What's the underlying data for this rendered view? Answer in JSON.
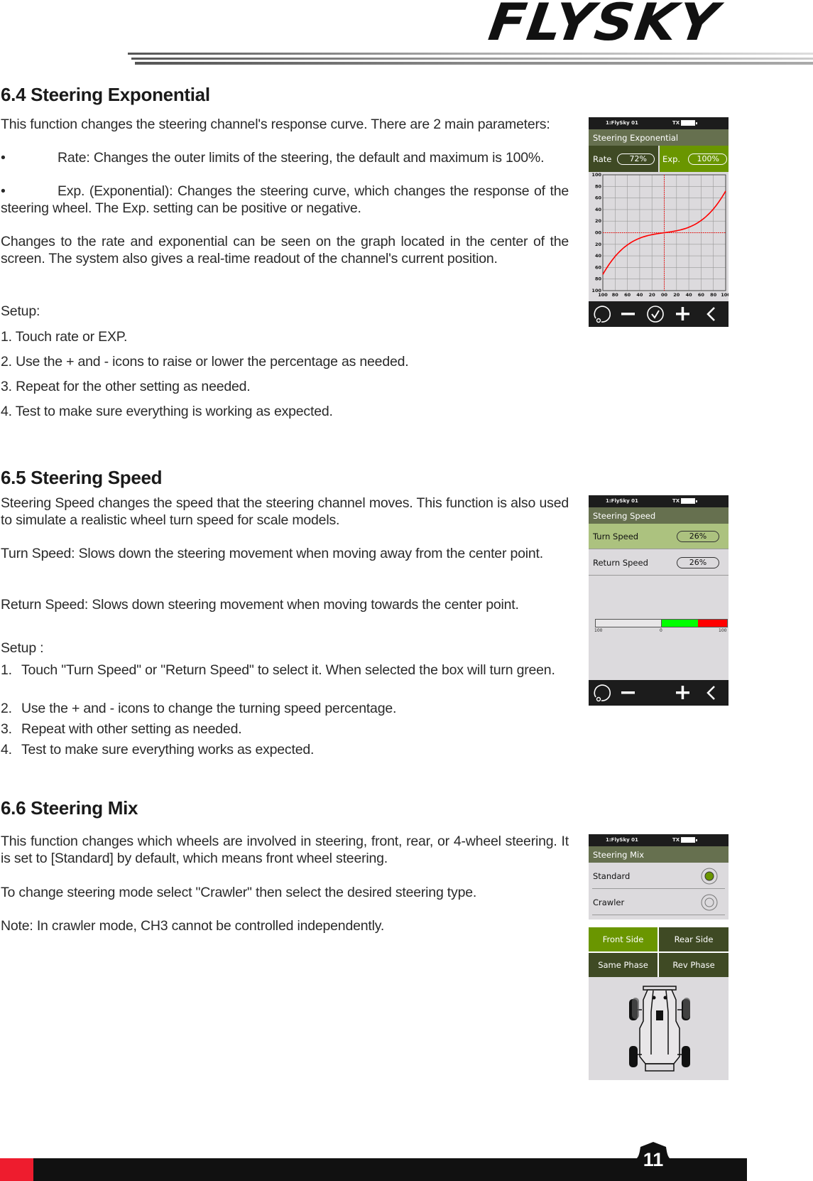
{
  "header": {
    "logo": "FLYSKY"
  },
  "s64": {
    "title": "6.4 Steering Exponential",
    "p1": "This function changes the steering channel's response curve. There are 2 main parameters:",
    "b1": "Rate: Changes the outer limits of the steering, the default and maximum is 100%.",
    "b2": "Exp. (Exponential): Changes the steering curve, which changes the response of the steering wheel. The Exp. setting can be positive or negative.",
    "p2": "Changes to the rate and exponential can be seen on the graph located in the center of the screen. The system also gives a real-time readout of the channel's current position.",
    "setup": "Setup:",
    "steps": [
      "1. Touch rate or EXP.",
      "2. Use the + and - icons to raise or lower the percentage as needed.",
      "3. Repeat for the other setting as needed.",
      "4. Test to make sure everything is working as expected."
    ],
    "screen": {
      "model": "1:FlySky 01",
      "tx": "TX",
      "title": "Steering Exponential",
      "rate_label": "Rate",
      "rate_value": "72%",
      "rate": 72,
      "exp_label": "Exp.",
      "exp_value": "100%",
      "exp": 100,
      "y_ticks": [
        "100",
        "80",
        "60",
        "40",
        "20",
        "00",
        "20",
        "40",
        "60",
        "80",
        "100"
      ],
      "x_ticks": [
        "100",
        "80",
        "60",
        "40",
        "20",
        "00",
        "20",
        "40",
        "60",
        "80",
        "100"
      ],
      "icons": [
        "reset-icon",
        "minus-icon",
        "check-icon",
        "plus-icon",
        "back-icon"
      ]
    }
  },
  "s65": {
    "title": "6.5 Steering Speed",
    "p1": "Steering Speed changes the speed that the steering channel moves. This function is also used to simulate a realistic wheel turn speed for scale models.",
    "p2": "Turn Speed: Slows down the steering movement when moving away from the center point.",
    "p3": "Return Speed: Slows down steering movement when moving towards the center point.",
    "setup": "Setup :",
    "steps": [
      {
        "n": "1.",
        "t": "Touch \"Turn Speed\" or \"Return Speed\" to select it. When selected the box will turn green."
      },
      {
        "n": "2.",
        "t": "Use the + and - icons to change the turning speed percentage."
      },
      {
        "n": "3.",
        "t": "Repeat with other setting as needed."
      },
      {
        "n": "4.",
        "t": "Test to make sure everything works as expected."
      }
    ],
    "screen": {
      "model": "1:FlySky 01",
      "tx": "TX",
      "title": "Steering Speed",
      "turn_label": "Turn Speed",
      "turn_value": "26%",
      "return_label": "Return Speed",
      "return_value": "26%",
      "bar_left": "100",
      "bar_mid": "0",
      "bar_right": "100",
      "green_fraction": 0.55,
      "red_fraction": 0.45
    }
  },
  "s66": {
    "title": "6.6 Steering Mix",
    "p1": "This function changes which wheels are involved in steering, front, rear, or 4-wheel steering. It is set to [Standard] by default, which means front wheel steering.",
    "p2": "To change steering mode select \"Crawler\" then select the desired steering type.",
    "p3": "Note: In crawler mode, CH3 cannot be controlled independently.",
    "screen": {
      "model": "1:FlySky 01",
      "tx": "TX",
      "title": "Steering Mix",
      "standard": "Standard",
      "crawler": "Crawler",
      "selected": "Standard",
      "front": "Front Side",
      "rear": "Rear Side",
      "same": "Same Phase",
      "rev": "Rev Phase",
      "active_button": "Front Side"
    }
  },
  "footer": {
    "page": "11"
  },
  "colors": {
    "accent_green": "#6a9600",
    "dark_olive": "#3f4a24",
    "title_olive": "#66704f",
    "selected_row": "#acc27f",
    "curve": "#ff0000",
    "footer_red": "#ee1c2e"
  }
}
